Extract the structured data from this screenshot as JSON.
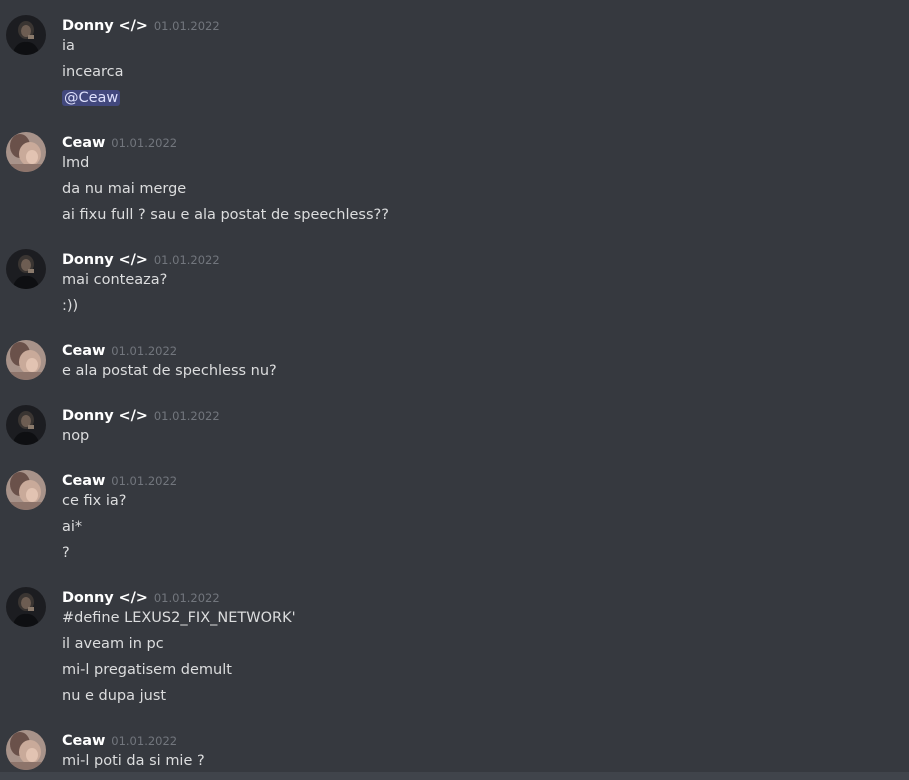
{
  "users": {
    "donny": {
      "name": "Donny </>"
    },
    "ceaw": {
      "name": "Ceaw"
    }
  },
  "messages": [
    {
      "user": "Donny </>",
      "time": "01.01.2022",
      "lines": [
        "ia",
        "incearca"
      ],
      "mention": "@Ceaw"
    },
    {
      "user": "Ceaw",
      "time": "01.01.2022",
      "lines": [
        "lmd",
        "da nu mai merge",
        "ai fixu full ? sau e ala postat de speechless??"
      ]
    },
    {
      "user": "Donny </>",
      "time": "01.01.2022",
      "lines": [
        "mai conteaza?",
        ":))"
      ]
    },
    {
      "user": "Ceaw",
      "time": "01.01.2022",
      "lines": [
        "e ala postat de spechless nu?"
      ]
    },
    {
      "user": "Donny </>",
      "time": "01.01.2022",
      "lines": [
        "nop"
      ]
    },
    {
      "user": "Ceaw",
      "time": "01.01.2022",
      "lines": [
        "ce fix ia?",
        "ai*",
        "?"
      ]
    },
    {
      "user": "Donny </>",
      "time": "01.01.2022",
      "lines": [
        "#define LEXUS2_FIX_NETWORK'",
        "il aveam in pc",
        "mi-l pregatisem demult",
        "nu e dupa just"
      ]
    },
    {
      "user": "Ceaw",
      "time": "01.01.2022",
      "lines": [
        "mi-l poti da si mie ?"
      ]
    }
  ],
  "colors": {
    "background": "#36393f",
    "username": "#ffffff",
    "timestamp": "#72767d",
    "text": "#dcddde",
    "mention_bg": "#4f5695"
  }
}
